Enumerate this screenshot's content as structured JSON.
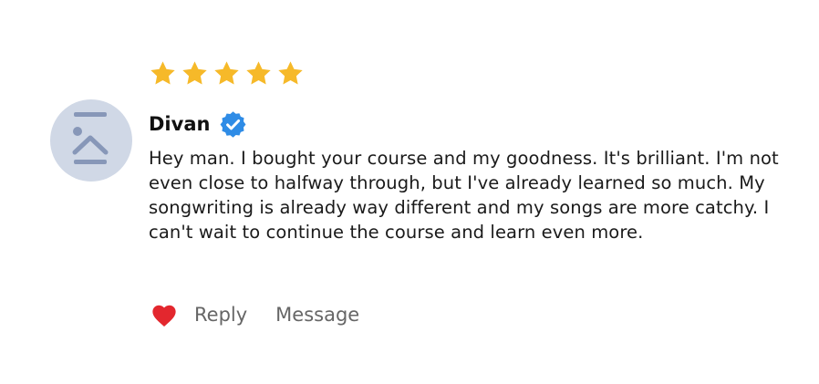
{
  "review": {
    "rating": 5,
    "max_rating": 5,
    "author": "Divan",
    "verified": true,
    "text": "Hey man. I bought your course and my goodness. It's brilliant. I'm not even close to halfway through, but I've already learned so much. My songwriting is already way different and my songs are more catchy. I can't wait to continue the course and learn even more.",
    "actions": {
      "reply_label": "Reply",
      "message_label": "Message"
    }
  },
  "colors": {
    "star": "#f6b929",
    "verified_badge": "#2f8ce6",
    "heart": "#e3272e",
    "avatar_bg": "#d0d8e6",
    "avatar_glyph": "#8797b8",
    "action_text": "#666666"
  },
  "icons": {
    "star": "star-icon",
    "verified": "verified-badge-icon",
    "like": "heart-icon",
    "avatar": "avatar-placeholder-icon"
  }
}
